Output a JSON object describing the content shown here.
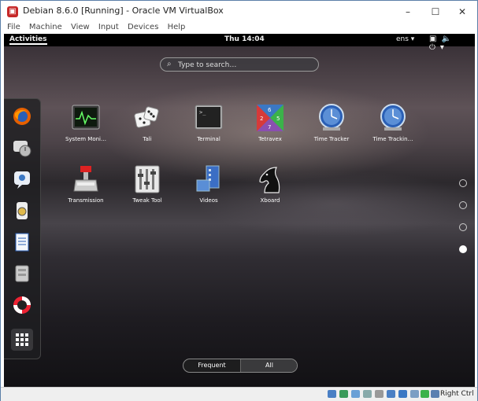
{
  "window": {
    "title": "Debian 8.6.0 [Running] - Oracle VM VirtualBox",
    "minimize": "–",
    "maximize": "☐",
    "close": "✕"
  },
  "menu": [
    "File",
    "Machine",
    "View",
    "Input",
    "Devices",
    "Help"
  ],
  "topbar": {
    "activities": "Activities",
    "clock": "Thu 14:04",
    "network": "ens ▾",
    "system_icons": "▣🔈⏻▾"
  },
  "search": {
    "placeholder": "Type to search…"
  },
  "dash": [
    "firefox-icon",
    "messages-icon",
    "empathy-icon",
    "rhythmbox-icon",
    "writer-icon",
    "files-icon",
    "help-icon",
    "show-apps-icon"
  ],
  "apps": [
    {
      "label": "System Moni…",
      "icon": "system-monitor-icon"
    },
    {
      "label": "Tali",
      "icon": "tali-icon"
    },
    {
      "label": "Terminal",
      "icon": "terminal-icon"
    },
    {
      "label": "Tetravex",
      "icon": "tetravex-icon"
    },
    {
      "label": "Time Tracker",
      "icon": "time-tracker-icon"
    },
    {
      "label": "Time Trackin…",
      "icon": "time-tracking-icon"
    },
    {
      "label": "Transmission",
      "icon": "transmission-icon"
    },
    {
      "label": "Tweak Tool",
      "icon": "tweak-tool-icon"
    },
    {
      "label": "Videos",
      "icon": "videos-icon"
    },
    {
      "label": "Xboard",
      "icon": "xboard-icon"
    }
  ],
  "toggle": {
    "frequent": "Frequent",
    "all": "All"
  },
  "status": {
    "host_key": "Right Ctrl"
  }
}
